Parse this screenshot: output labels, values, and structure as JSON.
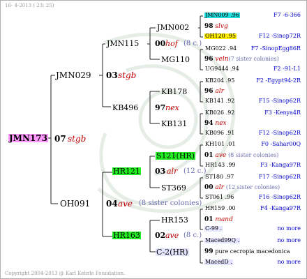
{
  "header": {
    "date": "16- 4-2013 ( 23: 25)"
  },
  "footer": {
    "copyright": "Copyright 2004-2013 @ Karl Kehrle Foundation."
  },
  "colors": {
    "magenta": "#ff99ff",
    "green": "#22ee22",
    "cyan": "#22dddd",
    "yellow": "#ffee00",
    "lavender": "#e4e4ff",
    "red": "#c00000",
    "blue": "#0000cc"
  },
  "tree": {
    "root": {
      "name": "JMN173",
      "year": "07",
      "breeder": "stgb"
    },
    "gen1": {
      "sire": {
        "name": "JMN029",
        "year": "03",
        "breeder": "stgb"
      },
      "dam": {
        "name": "OH091",
        "year": "04",
        "breeder": "ave",
        "note": "(8 sister colonies)"
      }
    },
    "gen2": {
      "a": {
        "name": "JMN115",
        "year": "00",
        "breeder": "hof",
        "note": "(8 c.)"
      },
      "b": {
        "name": "KB496",
        "year": "97",
        "breeder": "nex"
      },
      "c": {
        "name": "HR121",
        "year": "03",
        "breeder": "alr",
        "note": "(12 c.)"
      },
      "d": {
        "name": "HR163",
        "year": "02",
        "breeder": "ave",
        "note": "(8 c.)"
      }
    },
    "gen3": {
      "a1": {
        "name": "JMN002",
        "year": "98",
        "breeder": "slvg"
      },
      "a2": {
        "name": "MG110",
        "year": "96",
        "breeder": "veln",
        "note": "(7 sister colonies)"
      },
      "b1": {
        "name": "KB178",
        "year": "96",
        "breeder": "alr"
      },
      "b2": {
        "name": "KB131",
        "year": "94",
        "breeder": "nex"
      },
      "c1": {
        "name": "S121(HR)",
        "year": "01",
        "breeder": "ave",
        "note": "(8 sister colonies)"
      },
      "c2": {
        "name": "ST369",
        "year": "00",
        "breeder": "alr",
        "note": "(12 sister colonies)"
      },
      "d1": {
        "name": "HR153",
        "year": "01",
        "breeder": "mand"
      },
      "d2": {
        "name": "C-2(HR)",
        "year": "99",
        "breeder": "pure cecropia macedonica"
      }
    },
    "gen4": [
      {
        "name": "JMN009 .96",
        "ref": "F7 -6-366"
      },
      {
        "name": "OH120 .95",
        "ref": "F12 -Sinop72R"
      },
      {
        "name": "MG022 .94",
        "ref": "F7 -SinopEgg86R"
      },
      {
        "name": "UG9444 .94",
        "ref": "F2 -91-L1"
      },
      {
        "name": "KB204 .95",
        "ref": "F2 -Egypt94-2R"
      },
      {
        "name": "KB141 .92",
        "ref": "F15 -Sinop62R"
      },
      {
        "name": "KB026 .92",
        "ref": "F3 -Kenya4R"
      },
      {
        "name": "KB096 .91",
        "ref": "F12 -Sinop62R"
      },
      {
        "name": "KH101 .01",
        "ref": "F0 -Sahar00Q"
      },
      {
        "name": "HR143 .99",
        "ref": "F3 -Kanga97R"
      },
      {
        "name": "ST180 .97",
        "ref": "F17 -Sinop62R"
      },
      {
        "name": "ST061 .96",
        "ref": "F16 -Sinop62R"
      },
      {
        "name": "HR159 .00",
        "ref": "F4 -Kanga97R"
      },
      {
        "name": "C-99 .",
        "ref": "no more"
      },
      {
        "name": "Maced99Q .",
        "ref": "no more"
      },
      {
        "name": "MacedD .",
        "ref": "no more"
      }
    ]
  }
}
